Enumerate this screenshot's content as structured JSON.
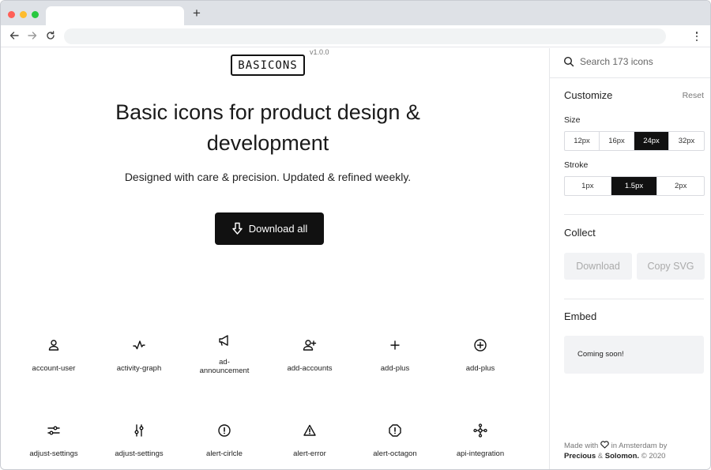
{
  "browser": {
    "new_tab_label": "+"
  },
  "hero": {
    "logo_text": "BASICONS",
    "version": "v1.0.0",
    "headline_line1": "Basic icons for product design &",
    "headline_line2": "development",
    "subline": "Designed with care & precision. Updated & refined weekly.",
    "download_label": "Download all"
  },
  "icons": [
    {
      "label": "account-user",
      "icon": "account-user-icon"
    },
    {
      "label": "activity-graph",
      "icon": "activity-graph-icon"
    },
    {
      "label": "ad-\nannouncement",
      "icon": "megaphone-icon"
    },
    {
      "label": "add-accounts",
      "icon": "add-accounts-icon"
    },
    {
      "label": "add-plus",
      "icon": "plus-icon"
    },
    {
      "label": "add-plus",
      "icon": "plus-circle-icon"
    },
    {
      "label": "adjust-settings",
      "icon": "sliders-horizontal-icon"
    },
    {
      "label": "adjust-settings",
      "icon": "sliders-vertical-icon"
    },
    {
      "label": "alert-cirlcle",
      "icon": "alert-circle-icon"
    },
    {
      "label": "alert-error",
      "icon": "alert-triangle-icon"
    },
    {
      "label": "alert-octagon",
      "icon": "alert-octagon-icon"
    },
    {
      "label": "api-integration",
      "icon": "api-integration-icon"
    }
  ],
  "sidebar": {
    "search_placeholder": "Search 173 icons",
    "customize": {
      "title": "Customize",
      "reset": "Reset",
      "size_label": "Size",
      "sizes": [
        "12px",
        "16px",
        "24px",
        "32px"
      ],
      "size_selected": "24px",
      "stroke_label": "Stroke",
      "strokes": [
        "1px",
        "1.5px",
        "2px"
      ],
      "stroke_selected": "1.5px"
    },
    "collect": {
      "title": "Collect",
      "download": "Download",
      "copy_svg": "Copy SVG"
    },
    "embed": {
      "title": "Embed",
      "coming_soon": "Coming soon!"
    },
    "footer": {
      "made_with": "Made with",
      "in_amsterdam": "in Amsterdam by",
      "author1": "Precious",
      "amp": "&",
      "author2": "Solomon.",
      "year": "© 2020"
    }
  }
}
